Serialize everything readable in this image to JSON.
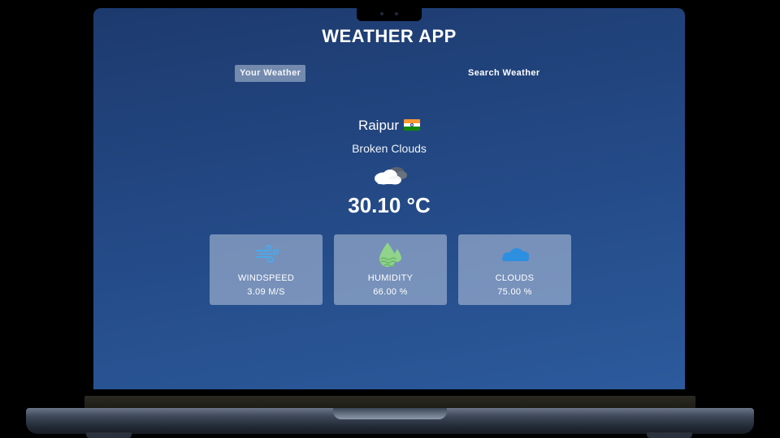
{
  "app": {
    "title": "WEATHER APP"
  },
  "tabs": [
    {
      "label": "Your Weather",
      "active": true
    },
    {
      "label": "Search Weather",
      "active": false
    }
  ],
  "weather": {
    "city": "Raipur",
    "country_flag": "india-flag-icon",
    "description": "Broken Clouds",
    "condition_icon": "broken-clouds-icon",
    "temperature": "30.10 °C"
  },
  "cards": {
    "windspeed": {
      "icon": "wind-icon",
      "label": "WINDSPEED",
      "value": "3.09 M/S"
    },
    "humidity": {
      "icon": "humidity-icon",
      "label": "HUMIDITY",
      "value": "66.00 %"
    },
    "clouds": {
      "icon": "clouds-icon",
      "label": "CLOUDS",
      "value": "75.00 %"
    }
  },
  "colors": {
    "screen_bg_top": "#1d3a6e",
    "screen_bg_bottom": "#2c5a9c",
    "wind_icon": "#4ea6e8",
    "humidity_icon": "#8fd48a",
    "clouds_icon": "#2d8fe0",
    "flag_saffron": "#ff9933",
    "flag_white": "#ffffff",
    "flag_green": "#138808"
  }
}
